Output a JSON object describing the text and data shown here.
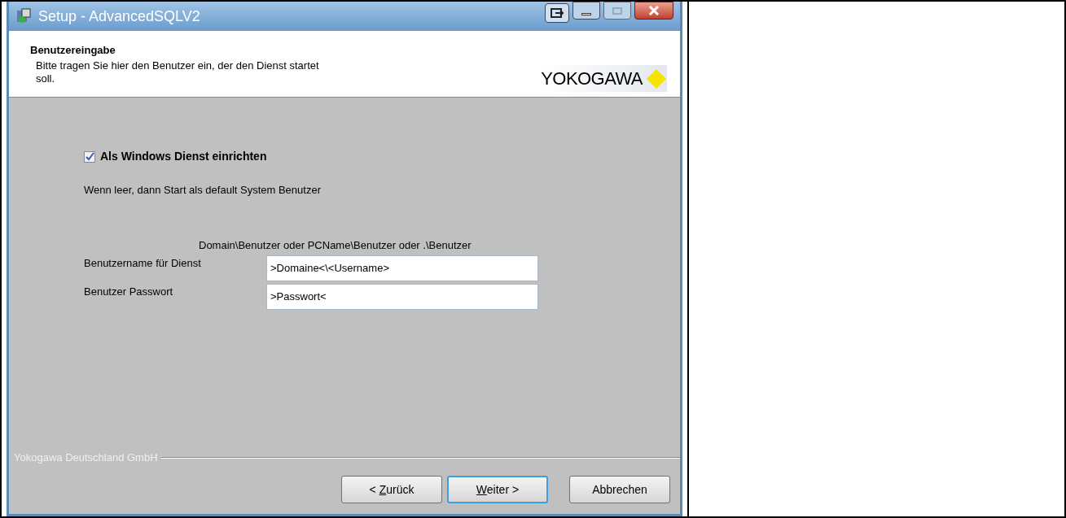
{
  "window": {
    "title": "Setup - AdvancedSQLV2"
  },
  "header": {
    "title": "Benutzereingabe",
    "subtitle": "Bitte tragen Sie hier den Benutzer ein, der den Dienst startet soll.",
    "logo": "YOKOGAWA"
  },
  "checkbox": {
    "label": "Als Windows Dienst einrichten",
    "checked": true
  },
  "hint": "Wenn leer, dann Start als default System Benutzer",
  "format_hint": "Domain\\Benutzer oder PCName\\Benutzer oder .\\Benutzer",
  "fields": [
    {
      "label": "Benutzername für Dienst",
      "value": ">Domaine<\\<Username>"
    },
    {
      "label": "Benutzer Passwort",
      "value": ">Passwort<"
    }
  ],
  "branding": "Yokogawa Deutschland GmbH",
  "buttons": [
    {
      "parts": [
        {
          "text": "< ",
          "underlined": false
        },
        {
          "text": "Z",
          "underlined": true
        },
        {
          "text": "urück",
          "underlined": false
        }
      ],
      "default": false
    },
    {
      "parts": [
        {
          "text": "W",
          "underlined": true
        },
        {
          "text": "eiter >",
          "underlined": false
        }
      ],
      "default": true
    },
    {
      "parts": [
        {
          "text": "Abbrechen",
          "underlined": false
        }
      ],
      "default": false
    }
  ]
}
